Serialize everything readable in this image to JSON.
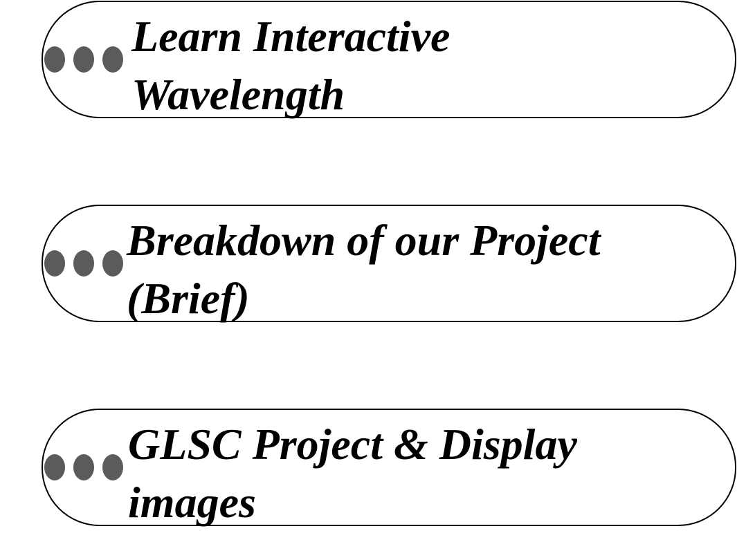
{
  "items": [
    {
      "line1": "Learn Interactive",
      "line2": "Wavelength",
      "icon": "bullet-dots-icon"
    },
    {
      "line1": "Breakdown of our Project",
      "line2": "(Brief)",
      "icon": "bullet-dots-icon"
    },
    {
      "line1": "GLSC Project & Display",
      "line2": "images",
      "icon": "bullet-dots-icon"
    }
  ],
  "colors": {
    "dots": "#5b5b5b",
    "border": "#000000"
  }
}
